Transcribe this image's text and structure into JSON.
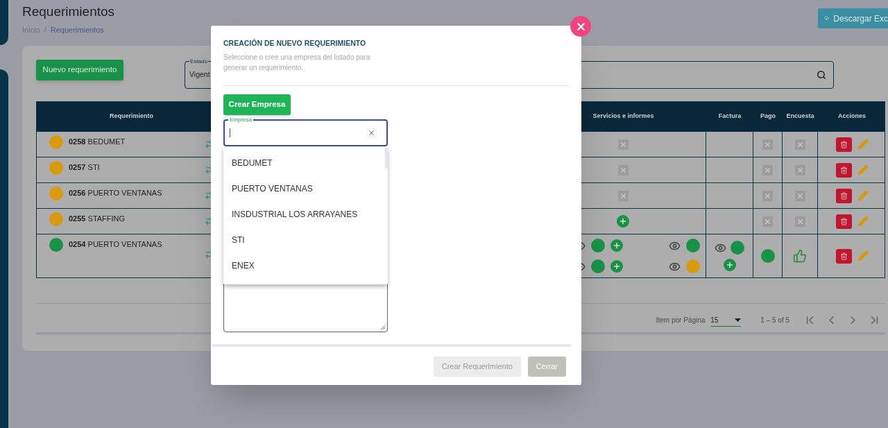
{
  "page": {
    "title": "Requerimientos",
    "breadcrumb": {
      "items": [
        "Inicio",
        "Requerimientos"
      ],
      "separator": "/"
    },
    "export_button": "Descargar Exc"
  },
  "toolbar": {
    "new_button": "Nuevo requerimiento",
    "status_filter": {
      "label": "Estado",
      "value": "Vigent"
    }
  },
  "table": {
    "columns": [
      "Requerimiento",
      "Servicios e informes",
      "Factura",
      "Pago",
      "Encuesta",
      "Acciones"
    ],
    "rows": [
      {
        "number": "0258",
        "name": "BEDUMET",
        "color": "#d99a12",
        "services": {
          "kind": "none"
        },
        "invoice": {
          "kind": "empty"
        },
        "payment": {
          "kind": "none"
        },
        "survey": {
          "kind": "none"
        }
      },
      {
        "number": "0257",
        "name": "STI",
        "color": "#d99a12",
        "services": {
          "kind": "none"
        },
        "invoice": {
          "kind": "empty"
        },
        "payment": {
          "kind": "none"
        },
        "survey": {
          "kind": "none"
        }
      },
      {
        "number": "0256",
        "name": "PUERTO VENTANAS",
        "color": "#d99a12",
        "services": {
          "kind": "none"
        },
        "invoice": {
          "kind": "empty"
        },
        "payment": {
          "kind": "none"
        },
        "survey": {
          "kind": "none"
        }
      },
      {
        "number": "0255",
        "name": "STAFFING",
        "color": "#d99a12",
        "services": {
          "kind": "add"
        },
        "invoice": {
          "kind": "empty"
        },
        "payment": {
          "kind": "none"
        },
        "survey": {
          "kind": "none"
        }
      },
      {
        "number": "0254",
        "name": "PUERTO VENTANAS",
        "color": "#1a9148",
        "services": {
          "kind": "detail",
          "lines": [
            {
              "dots": [
                {
                  "color": "#1a9148"
                },
                {
                  "color": "#1a9148"
                }
              ]
            },
            {
              "dots": [
                {
                  "color": "#1a9148"
                },
                {
                  "color": "#d99a12"
                }
              ]
            }
          ]
        },
        "invoice": {
          "kind": "detail",
          "color": "#1a9148"
        },
        "payment": {
          "kind": "done",
          "color": "#1a9148"
        },
        "survey": {
          "kind": "approved"
        }
      }
    ]
  },
  "pagination": {
    "label": "Item por Página",
    "page_size": "15",
    "range": "1 – 5 of 5"
  },
  "dialog": {
    "title": "CREACIÓN DE NUEVO REQUERIMIENTO",
    "subtitle": "Seleccione o cree una empresa del listado para generar un requerimiento.",
    "create_company_button": "Crear Empresa",
    "company_field": {
      "label": "Empresa"
    },
    "options": [
      "BEDUMET",
      "PUERTO VENTANAS",
      "INSDUSTRIAL LOS ARRAYANES",
      "STI",
      "ENEX"
    ],
    "buttons": [
      {
        "label": "Crear Requerimiento",
        "disabled": true
      },
      {
        "label": "Cerrar",
        "disabled": false
      }
    ]
  }
}
